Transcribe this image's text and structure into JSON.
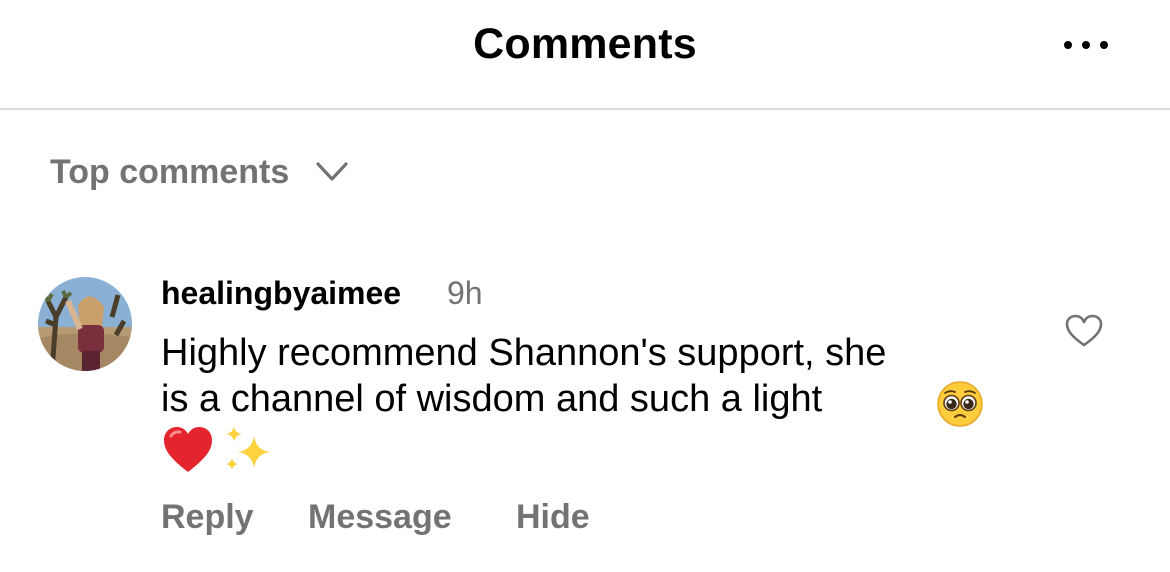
{
  "header": {
    "title": "Comments",
    "more_icon": "more-horizontal-icon"
  },
  "sort": {
    "label": "Top comments",
    "icon": "chevron-down-icon"
  },
  "comment": {
    "username": "healingbyaimee",
    "time": "9h",
    "text_line1": "Highly recommend Shannon's support, she",
    "text_line2": "is a channel of wisdom and such a light",
    "emojis": [
      "pleading-face",
      "red-heart",
      "sparkles"
    ],
    "like_icon": "heart-outline-icon",
    "actions": {
      "reply": "Reply",
      "message": "Message",
      "hide": "Hide"
    }
  },
  "colors": {
    "text_primary": "#000000",
    "text_secondary": "#737373",
    "divider": "#dbdbdb"
  }
}
